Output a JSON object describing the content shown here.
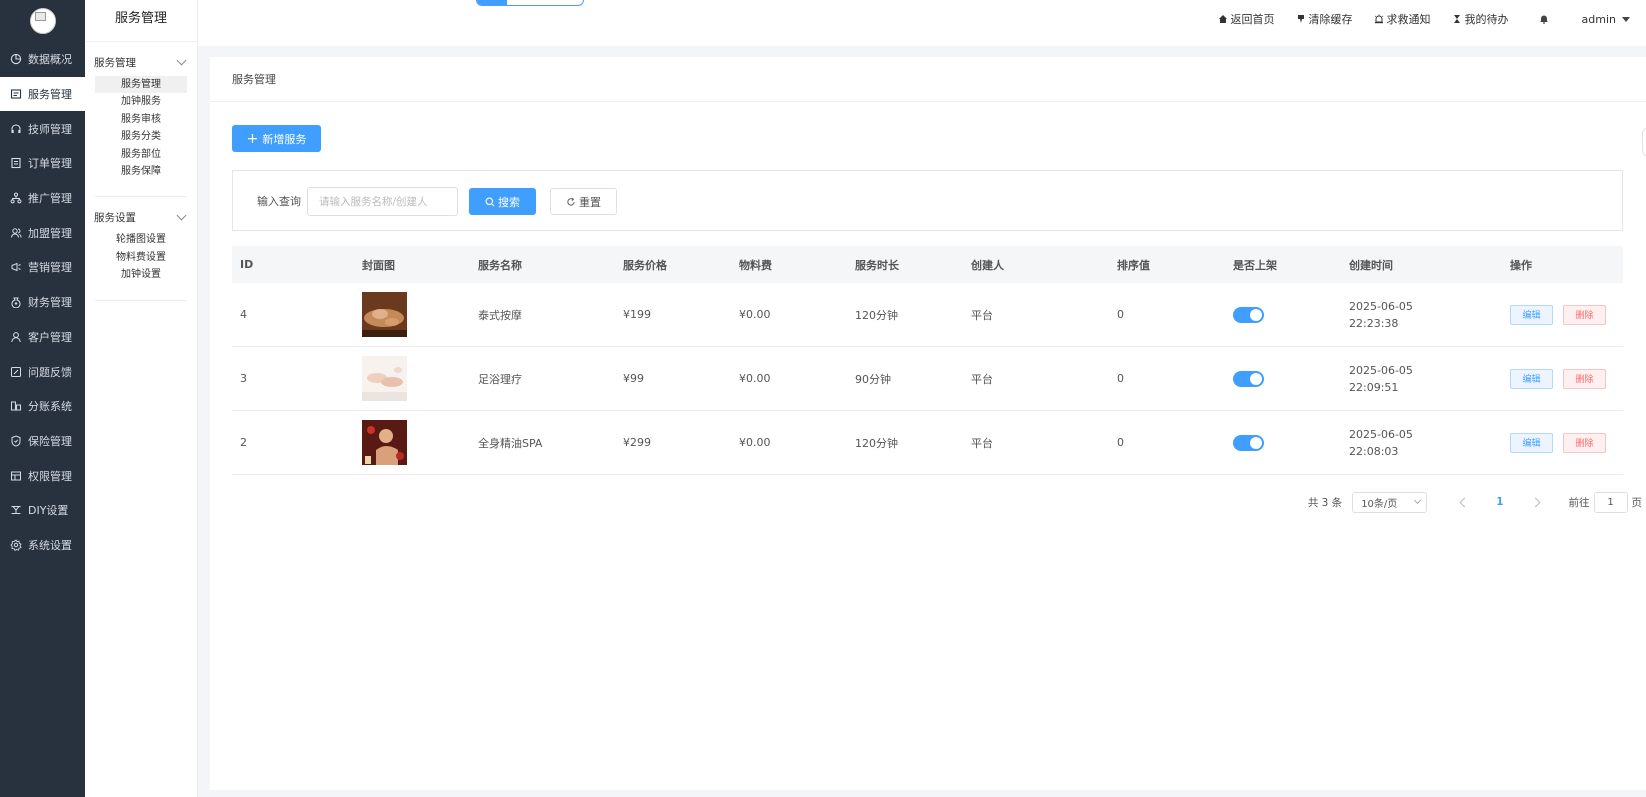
{
  "sidebar": {
    "items": [
      {
        "label": "数据概况",
        "icon": "pie-chart-icon"
      },
      {
        "label": "服务管理",
        "icon": "service-icon"
      },
      {
        "label": "技师管理",
        "icon": "headset-icon"
      },
      {
        "label": "订单管理",
        "icon": "order-icon"
      },
      {
        "label": "推广管理",
        "icon": "network-icon"
      },
      {
        "label": "加盟管理",
        "icon": "user-group-icon"
      },
      {
        "label": "营销管理",
        "icon": "marketing-icon"
      },
      {
        "label": "财务管理",
        "icon": "money-bag-icon"
      },
      {
        "label": "客户管理",
        "icon": "customer-icon"
      },
      {
        "label": "问题反馈",
        "icon": "feedback-icon"
      },
      {
        "label": "分账系统",
        "icon": "split-account-icon"
      },
      {
        "label": "保险管理",
        "icon": "shield-icon"
      },
      {
        "label": "权限管理",
        "icon": "permission-icon"
      },
      {
        "label": "DIY设置",
        "icon": "diy-icon"
      },
      {
        "label": "系统设置",
        "icon": "gear-icon"
      }
    ],
    "active_index": 1
  },
  "submenu": {
    "title": "服务管理",
    "groups": [
      {
        "label": "服务管理",
        "items": [
          "服务管理",
          "加钟服务",
          "服务审核",
          "服务分类",
          "服务部位",
          "服务保障"
        ]
      },
      {
        "label": "服务设置",
        "items": [
          "轮播图设置",
          "物料费设置",
          "加钟设置"
        ]
      }
    ]
  },
  "topbar": {
    "links": [
      "返回首页",
      "清除缓存",
      "求救通知",
      "我的待办"
    ],
    "user": "admin"
  },
  "breadcrumb": "服务管理",
  "add_button": "新增服务",
  "search": {
    "label": "输入查询",
    "placeholder": "请输入服务名称/创建人",
    "search_button": "搜索",
    "reset_button": "重置"
  },
  "table": {
    "columns": [
      "ID",
      "封面图",
      "服务名称",
      "服务价格",
      "物料费",
      "服务时长",
      "创建人",
      "排序值",
      "是否上架",
      "创建时间",
      "操作"
    ],
    "rows": [
      {
        "id": "4",
        "name": "泰式按摩",
        "price": "¥199",
        "material": "¥0.00",
        "duration": "120分钟",
        "creator": "平台",
        "sort": "0",
        "listed": true,
        "date": "2025-06-05",
        "time": "22:23:38",
        "thumb": "thai-massage"
      },
      {
        "id": "3",
        "name": "足浴理疗",
        "price": "¥99",
        "material": "¥0.00",
        "duration": "90分钟",
        "creator": "平台",
        "sort": "0",
        "listed": true,
        "date": "2025-06-05",
        "time": "22:09:51",
        "thumb": "foot-bath"
      },
      {
        "id": "2",
        "name": "全身精油SPA",
        "price": "¥299",
        "material": "¥0.00",
        "duration": "120分钟",
        "creator": "平台",
        "sort": "0",
        "listed": true,
        "date": "2025-06-05",
        "time": "22:08:03",
        "thumb": "oil-spa"
      }
    ],
    "edit_label": "编辑",
    "delete_label": "删除"
  },
  "pagination": {
    "total": "共 3 条",
    "page_size": "10条/页",
    "current": "1",
    "goto_prefix": "前往",
    "goto_value": "1",
    "goto_suffix": "页"
  },
  "colors": {
    "primary": "#409eff",
    "sidebar_bg": "#28323f",
    "danger": "#f56c6c"
  }
}
